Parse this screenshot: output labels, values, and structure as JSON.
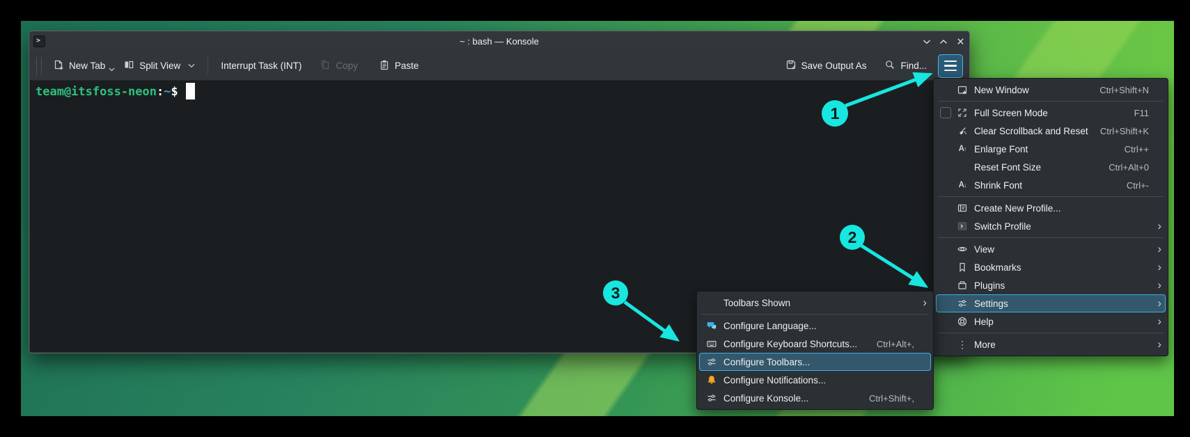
{
  "appearance": {
    "accent": "#3daee9",
    "annotation_color": "#18e6e0",
    "annotation_number_color": "#05201e",
    "prompt_green": "#2ec27e",
    "prompt_blue": "#3f9bdc",
    "terminal_bg": "#1b1e20",
    "titlebar_bg": "#32373b",
    "menu_bg": "#2b3034",
    "highlight_fill": "#33576b",
    "notification_bell_orange": "#f5a623",
    "language_bubble_blue": "#3daee9",
    "wallpaper_green_dark": "#1e7154",
    "wallpaper_green_bright": "#5fc548"
  },
  "window": {
    "title": "~ : bash — Konsole"
  },
  "toolbar": {
    "new_tab": "New Tab",
    "split_view": "Split View",
    "interrupt_task": "Interrupt Task (INT)",
    "copy": "Copy",
    "paste": "Paste",
    "save_output_as": "Save Output As",
    "find": "Find..."
  },
  "terminal": {
    "prompt_user": "team@itsfoss-neon",
    "prompt_separator": ":",
    "prompt_path": "~",
    "prompt_symbol": "$"
  },
  "main_menu": {
    "items": [
      {
        "label": "New Window",
        "shortcut": "Ctrl+Shift+N"
      },
      {
        "label": "Full Screen Mode",
        "shortcut": "F11"
      },
      {
        "label": "Clear Scrollback and Reset",
        "shortcut": "Ctrl+Shift+K"
      },
      {
        "label": "Enlarge Font",
        "shortcut": "Ctrl++"
      },
      {
        "label": "Reset Font Size",
        "shortcut": "Ctrl+Alt+0"
      },
      {
        "label": "Shrink Font",
        "shortcut": "Ctrl+-"
      },
      {
        "label": "Create New Profile..."
      },
      {
        "label": "Switch Profile"
      },
      {
        "label": "View"
      },
      {
        "label": "Bookmarks"
      },
      {
        "label": "Plugins"
      },
      {
        "label": "Settings"
      },
      {
        "label": "Help"
      },
      {
        "label": "More"
      }
    ]
  },
  "submenu": {
    "items": [
      {
        "label": "Toolbars Shown"
      },
      {
        "label": "Configure Language..."
      },
      {
        "label": "Configure Keyboard Shortcuts...",
        "shortcut": "Ctrl+Alt+,"
      },
      {
        "label": "Configure Toolbars..."
      },
      {
        "label": "Configure Notifications..."
      },
      {
        "label": "Configure Konsole...",
        "shortcut": "Ctrl+Shift+,"
      }
    ]
  },
  "icons": {
    "chevron_right": "›",
    "more_vertical": "⋮",
    "letter_a": "A",
    "arrow_up": "↑",
    "arrow_down": "↓",
    "prompt_glyph": ">"
  },
  "annotations": {
    "steps": [
      {
        "label": "1"
      },
      {
        "label": "2"
      },
      {
        "label": "3"
      }
    ]
  }
}
